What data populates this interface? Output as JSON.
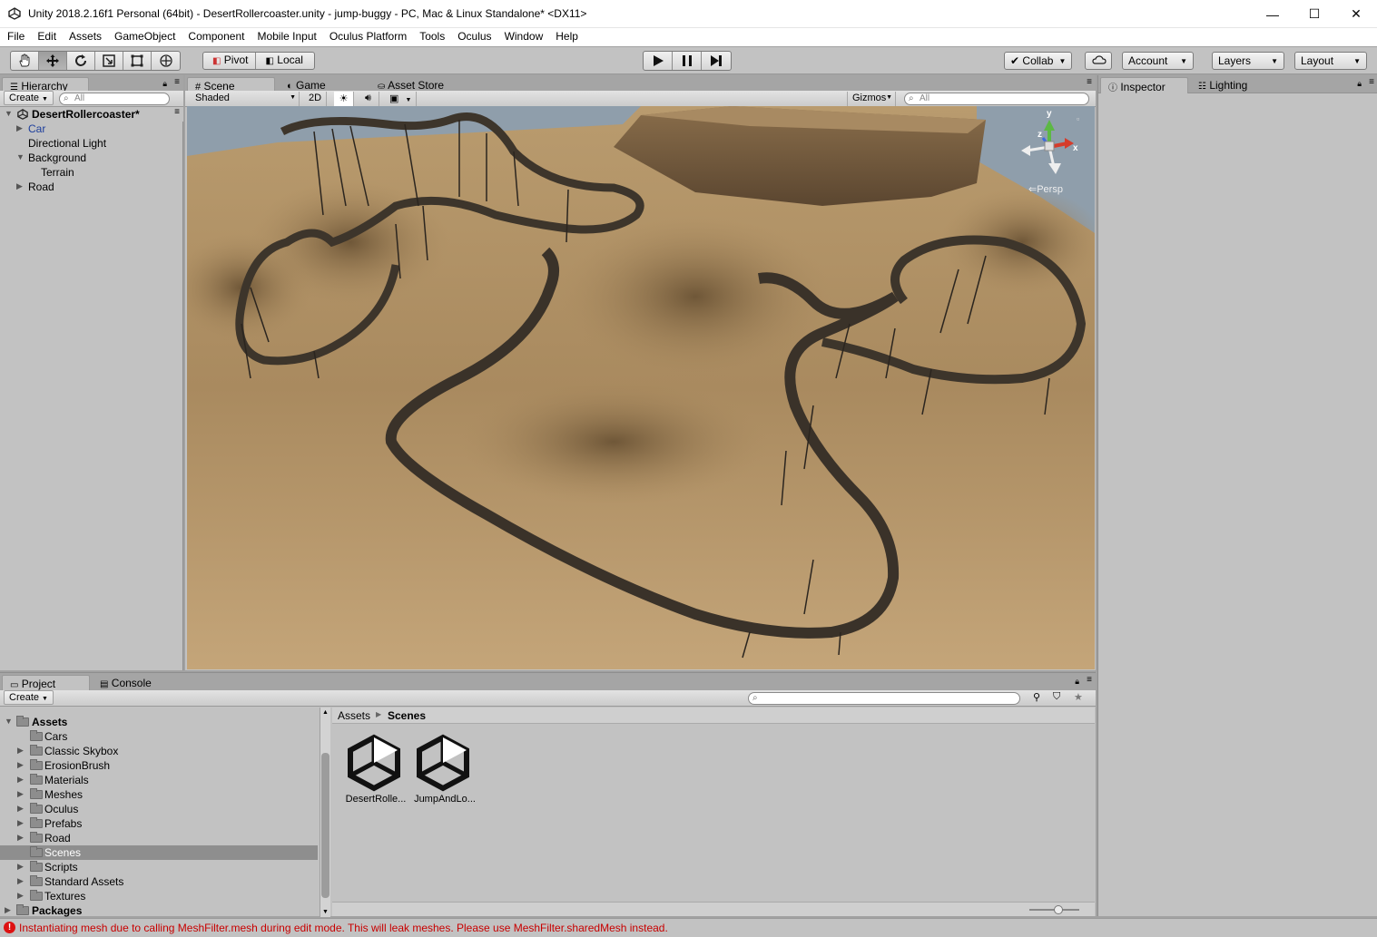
{
  "window": {
    "title": "Unity 2018.2.16f1 Personal (64bit) - DesertRollercoaster.unity - jump-buggy - PC, Mac & Linux Standalone* <DX11>",
    "minimize": "—",
    "maximize": "☐",
    "close": "✕"
  },
  "menu": [
    "File",
    "Edit",
    "Assets",
    "GameObject",
    "Component",
    "Mobile Input",
    "Oculus Platform",
    "Tools",
    "Oculus",
    "Window",
    "Help"
  ],
  "toolbar": {
    "pivot": "Pivot",
    "local": "Local",
    "collab": "Collab",
    "account": "Account",
    "layers": "Layers",
    "layout": "Layout"
  },
  "hierarchy": {
    "tab": "Hierarchy",
    "create": "Create",
    "search_placeholder": "All",
    "scene_name": "DesertRollercoaster*",
    "items": [
      {
        "label": "Car",
        "indent": 1,
        "expandable": true,
        "prefab": true
      },
      {
        "label": "Directional Light",
        "indent": 1,
        "expandable": false,
        "prefab": false
      },
      {
        "label": "Background",
        "indent": 1,
        "expandable": true,
        "expanded": true,
        "prefab": false
      },
      {
        "label": "Terrain",
        "indent": 2,
        "expandable": false,
        "prefab": false
      },
      {
        "label": "Road",
        "indent": 1,
        "expandable": true,
        "prefab": false
      }
    ]
  },
  "scene": {
    "tabs": [
      "Scene",
      "Game",
      "Asset Store"
    ],
    "shading_mode": "Shaded",
    "mode_2d": "2D",
    "gizmos": "Gizmos",
    "search_placeholder": "All",
    "projection": "Persp",
    "axis_x": "x",
    "axis_y": "y",
    "axis_z": "z"
  },
  "inspector": {
    "tabs": [
      "Inspector",
      "Lighting"
    ]
  },
  "project": {
    "tabs": [
      "Project",
      "Console"
    ],
    "create": "Create",
    "breadcrumb": [
      "Assets",
      "Scenes"
    ],
    "root_folder": "Assets",
    "folders": [
      {
        "label": "Cars",
        "expandable": false
      },
      {
        "label": "Classic Skybox",
        "expandable": true
      },
      {
        "label": "ErosionBrush",
        "expandable": true
      },
      {
        "label": "Materials",
        "expandable": true
      },
      {
        "label": "Meshes",
        "expandable": true
      },
      {
        "label": "Oculus",
        "expandable": true
      },
      {
        "label": "Prefabs",
        "expandable": true
      },
      {
        "label": "Road",
        "expandable": true
      },
      {
        "label": "Scenes",
        "expandable": false,
        "selected": true
      },
      {
        "label": "Scripts",
        "expandable": true
      },
      {
        "label": "Standard Assets",
        "expandable": true
      },
      {
        "label": "Textures",
        "expandable": true
      }
    ],
    "packages_folder": "Packages",
    "assets": [
      {
        "label": "DesertRolle...",
        "type": "scene"
      },
      {
        "label": "JumpAndLo...",
        "type": "scene"
      }
    ]
  },
  "status": {
    "message": "Instantiating mesh due to calling MeshFilter.mesh during edit mode. This will leak meshes. Please use MeshFilter.sharedMesh instead.",
    "color": "#c80000"
  }
}
